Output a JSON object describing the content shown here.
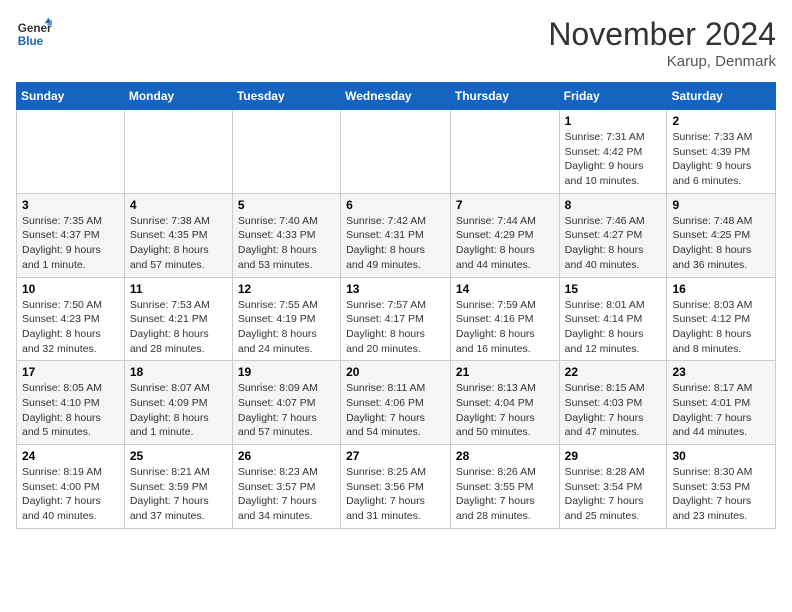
{
  "header": {
    "logo_line1": "General",
    "logo_line2": "Blue",
    "month": "November 2024",
    "location": "Karup, Denmark"
  },
  "weekdays": [
    "Sunday",
    "Monday",
    "Tuesday",
    "Wednesday",
    "Thursday",
    "Friday",
    "Saturday"
  ],
  "weeks": [
    [
      {
        "day": "",
        "info": ""
      },
      {
        "day": "",
        "info": ""
      },
      {
        "day": "",
        "info": ""
      },
      {
        "day": "",
        "info": ""
      },
      {
        "day": "",
        "info": ""
      },
      {
        "day": "1",
        "info": "Sunrise: 7:31 AM\nSunset: 4:42 PM\nDaylight: 9 hours and 10 minutes."
      },
      {
        "day": "2",
        "info": "Sunrise: 7:33 AM\nSunset: 4:39 PM\nDaylight: 9 hours and 6 minutes."
      }
    ],
    [
      {
        "day": "3",
        "info": "Sunrise: 7:35 AM\nSunset: 4:37 PM\nDaylight: 9 hours and 1 minute."
      },
      {
        "day": "4",
        "info": "Sunrise: 7:38 AM\nSunset: 4:35 PM\nDaylight: 8 hours and 57 minutes."
      },
      {
        "day": "5",
        "info": "Sunrise: 7:40 AM\nSunset: 4:33 PM\nDaylight: 8 hours and 53 minutes."
      },
      {
        "day": "6",
        "info": "Sunrise: 7:42 AM\nSunset: 4:31 PM\nDaylight: 8 hours and 49 minutes."
      },
      {
        "day": "7",
        "info": "Sunrise: 7:44 AM\nSunset: 4:29 PM\nDaylight: 8 hours and 44 minutes."
      },
      {
        "day": "8",
        "info": "Sunrise: 7:46 AM\nSunset: 4:27 PM\nDaylight: 8 hours and 40 minutes."
      },
      {
        "day": "9",
        "info": "Sunrise: 7:48 AM\nSunset: 4:25 PM\nDaylight: 8 hours and 36 minutes."
      }
    ],
    [
      {
        "day": "10",
        "info": "Sunrise: 7:50 AM\nSunset: 4:23 PM\nDaylight: 8 hours and 32 minutes."
      },
      {
        "day": "11",
        "info": "Sunrise: 7:53 AM\nSunset: 4:21 PM\nDaylight: 8 hours and 28 minutes."
      },
      {
        "day": "12",
        "info": "Sunrise: 7:55 AM\nSunset: 4:19 PM\nDaylight: 8 hours and 24 minutes."
      },
      {
        "day": "13",
        "info": "Sunrise: 7:57 AM\nSunset: 4:17 PM\nDaylight: 8 hours and 20 minutes."
      },
      {
        "day": "14",
        "info": "Sunrise: 7:59 AM\nSunset: 4:16 PM\nDaylight: 8 hours and 16 minutes."
      },
      {
        "day": "15",
        "info": "Sunrise: 8:01 AM\nSunset: 4:14 PM\nDaylight: 8 hours and 12 minutes."
      },
      {
        "day": "16",
        "info": "Sunrise: 8:03 AM\nSunset: 4:12 PM\nDaylight: 8 hours and 8 minutes."
      }
    ],
    [
      {
        "day": "17",
        "info": "Sunrise: 8:05 AM\nSunset: 4:10 PM\nDaylight: 8 hours and 5 minutes."
      },
      {
        "day": "18",
        "info": "Sunrise: 8:07 AM\nSunset: 4:09 PM\nDaylight: 8 hours and 1 minute."
      },
      {
        "day": "19",
        "info": "Sunrise: 8:09 AM\nSunset: 4:07 PM\nDaylight: 7 hours and 57 minutes."
      },
      {
        "day": "20",
        "info": "Sunrise: 8:11 AM\nSunset: 4:06 PM\nDaylight: 7 hours and 54 minutes."
      },
      {
        "day": "21",
        "info": "Sunrise: 8:13 AM\nSunset: 4:04 PM\nDaylight: 7 hours and 50 minutes."
      },
      {
        "day": "22",
        "info": "Sunrise: 8:15 AM\nSunset: 4:03 PM\nDaylight: 7 hours and 47 minutes."
      },
      {
        "day": "23",
        "info": "Sunrise: 8:17 AM\nSunset: 4:01 PM\nDaylight: 7 hours and 44 minutes."
      }
    ],
    [
      {
        "day": "24",
        "info": "Sunrise: 8:19 AM\nSunset: 4:00 PM\nDaylight: 7 hours and 40 minutes."
      },
      {
        "day": "25",
        "info": "Sunrise: 8:21 AM\nSunset: 3:59 PM\nDaylight: 7 hours and 37 minutes."
      },
      {
        "day": "26",
        "info": "Sunrise: 8:23 AM\nSunset: 3:57 PM\nDaylight: 7 hours and 34 minutes."
      },
      {
        "day": "27",
        "info": "Sunrise: 8:25 AM\nSunset: 3:56 PM\nDaylight: 7 hours and 31 minutes."
      },
      {
        "day": "28",
        "info": "Sunrise: 8:26 AM\nSunset: 3:55 PM\nDaylight: 7 hours and 28 minutes."
      },
      {
        "day": "29",
        "info": "Sunrise: 8:28 AM\nSunset: 3:54 PM\nDaylight: 7 hours and 25 minutes."
      },
      {
        "day": "30",
        "info": "Sunrise: 8:30 AM\nSunset: 3:53 PM\nDaylight: 7 hours and 23 minutes."
      }
    ]
  ]
}
